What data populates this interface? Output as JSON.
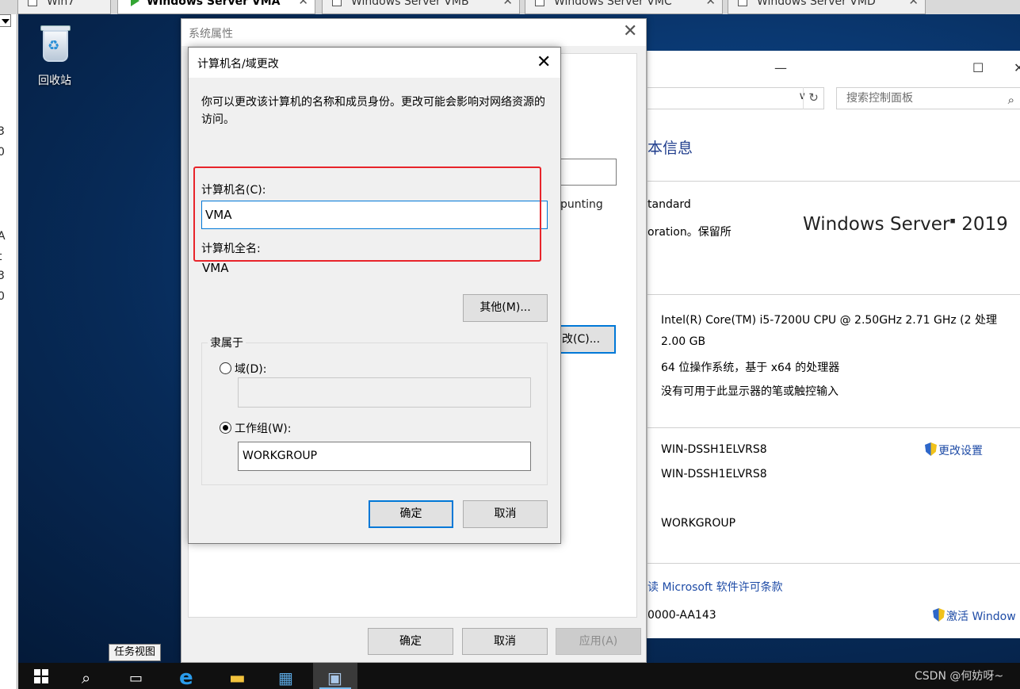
{
  "vm_tabs": [
    {
      "label": "Win7",
      "active": false
    },
    {
      "label": "Windows Server VMA",
      "active": true
    },
    {
      "label": "Windows Server VMB",
      "active": false
    },
    {
      "label": "Windows Server VMC",
      "active": false
    },
    {
      "label": "Windows Server VMD",
      "active": false
    }
  ],
  "host_fragments": [
    "3",
    "0",
    "A",
    "t",
    "3",
    "0"
  ],
  "desktop": {
    "recycle_bin_label": "回收站"
  },
  "control_panel": {
    "minimize_glyph": "—",
    "maximize_glyph": "☐",
    "close_glyph": "✕",
    "search_placeholder": "搜索控制面板",
    "heading": "本信息",
    "edition": "tandard",
    "copyright": "oration。保留所",
    "logo_text": "Windows Server",
    "logo_year": "2019",
    "processor": "Intel(R) Core(TM) i5-7200U CPU @ 2.50GHz   2.71 GHz  (2 处理",
    "ram": "2.00 GB",
    "system_type": "64 位操作系统，基于 x64 的处理器",
    "pen_touch": "没有可用于此显示器的笔或触控输入",
    "computer_name": "WIN-DSSH1ELVRS8",
    "full_computer_name": "WIN-DSSH1ELVRS8",
    "workgroup": "WORKGROUP",
    "change_settings": "更改设置",
    "license_link": "读 Microsoft 软件许可条款",
    "product_id": "0000-AA143",
    "activate_link": "激活 Window"
  },
  "system_properties": {
    "title": "系统属性",
    "change_button": "改(C)...",
    "ounting_fragment": "punting",
    "ok": "确定",
    "cancel": "取消",
    "apply": "应用(A)"
  },
  "computer_name_dialog": {
    "title": "计算机名/域更改",
    "description": "你可以更改该计算机的名称和成员身份。更改可能会影响对网络资源的访问。",
    "computer_name_label": "计算机名(C):",
    "computer_name_value": "VMA",
    "full_name_label": "计算机全名:",
    "full_name_value": "VMA",
    "more_button": "其他(M)...",
    "member_of_label": "隶属于",
    "domain_label": "域(D):",
    "domain_value": "",
    "workgroup_label": "工作组(W):",
    "workgroup_value": "WORKGROUP",
    "selected_membership": "workgroup",
    "ok": "确定",
    "cancel": "取消"
  },
  "tooltip": "任务视图",
  "taskbar": {
    "icons": [
      "start-icon",
      "search-icon",
      "task-view-icon",
      "internet-explorer-icon",
      "file-explorer-icon",
      "server-manager-icon",
      "system-properties-icon"
    ]
  },
  "watermark": "CSDN @何妨呀~",
  "colors": {
    "accent": "#0078d7",
    "highlight": "#e8242a",
    "link": "#1e4ba6"
  }
}
